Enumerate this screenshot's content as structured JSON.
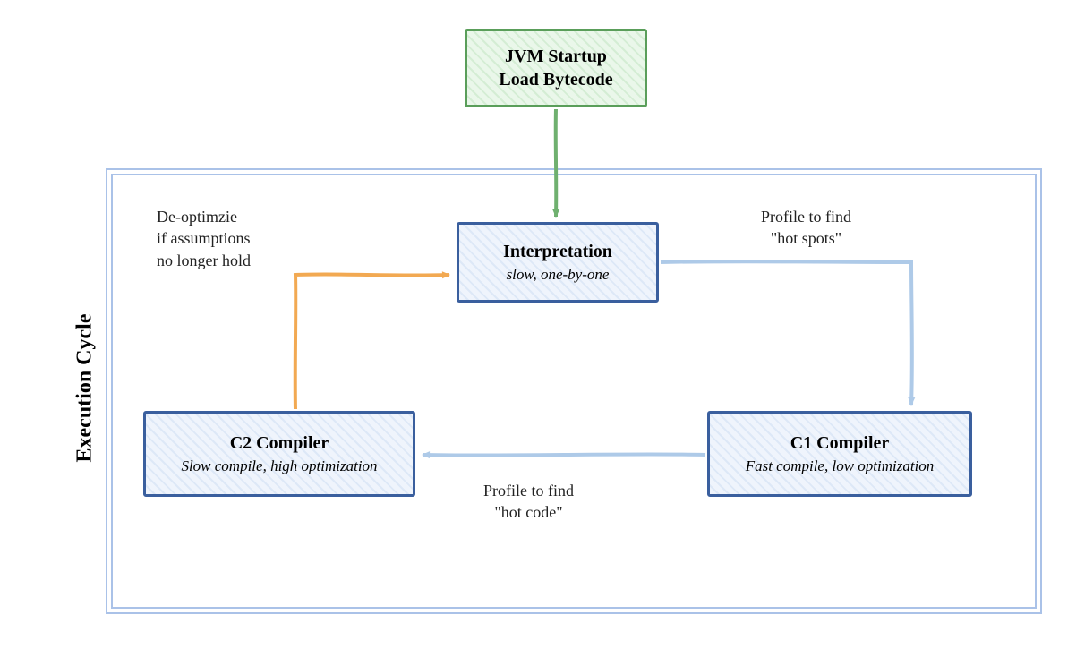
{
  "boxes": {
    "startup": {
      "line1": "JVM Startup",
      "line2": "Load Bytecode"
    },
    "interpretation": {
      "title": "Interpretation",
      "sub": "slow, one-by-one"
    },
    "c1": {
      "title": "C1 Compiler",
      "sub": "Fast compile, low optimization"
    },
    "c2": {
      "title": "C2 Compiler",
      "sub": "Slow compile, high optimization"
    }
  },
  "outer_label": "Execution Cycle",
  "edges": {
    "deopt": {
      "line1": "De-optimzie",
      "line2": "if assumptions",
      "line3": "no longer hold"
    },
    "profile_hotspots": {
      "line1": "Profile to find",
      "line2": "\"hot spots\""
    },
    "profile_hotcode": {
      "line1": "Profile to find",
      "line2": "\"hot code\""
    }
  },
  "colors": {
    "green": "#6fb06f",
    "blue_border": "#3a5f9e",
    "light_blue": "#aecae8",
    "orange": "#f2a952"
  }
}
